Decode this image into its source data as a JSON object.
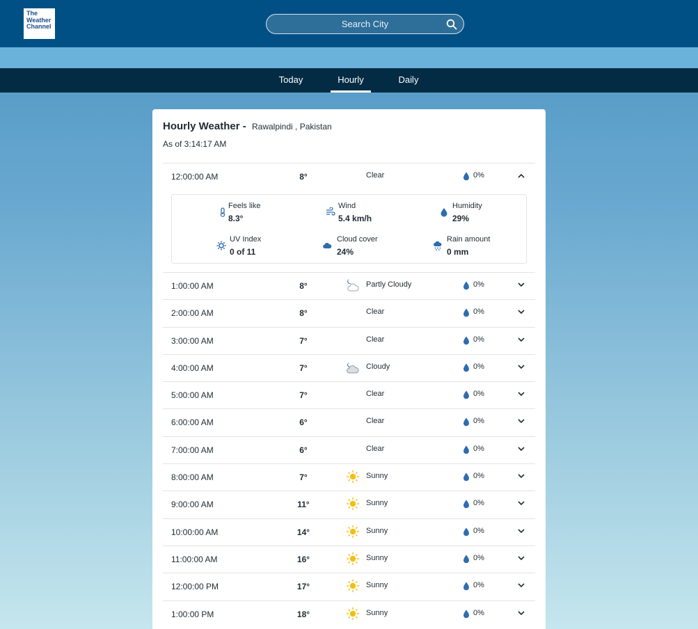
{
  "brand": {
    "logo_lines": [
      "The",
      "Weather",
      "Channel"
    ]
  },
  "search": {
    "placeholder": "Search City",
    "icon": "search-icon"
  },
  "nav": {
    "tabs": [
      "Today",
      "Hourly",
      "Daily"
    ],
    "active": "Hourly"
  },
  "header": {
    "title": "Hourly Weather -",
    "location": "Rawalpindi , Pakistan",
    "as_of": "As of 3:14:17 AM"
  },
  "colors": {
    "topbar": "#005086",
    "nav": "#032c44",
    "accent_icon": "#2f6cb0",
    "sun": "#f2c012"
  },
  "details": {
    "feels_like": {
      "label": "Feels like",
      "value": "8.3°",
      "icon": "thermometer-icon"
    },
    "wind": {
      "label": "Wind",
      "value": "5.4 km/h",
      "icon": "wind-icon"
    },
    "humidity": {
      "label": "Humidity",
      "value": "29%",
      "icon": "droplet-icon"
    },
    "uv_index": {
      "label": "UV Index",
      "value": "0 of 11",
      "icon": "uv-icon"
    },
    "cloud_cover": {
      "label": "Cloud cover",
      "value": "24%",
      "icon": "cloud-icon"
    },
    "rain_amount": {
      "label": "Rain amount",
      "value": "0 mm",
      "icon": "rain-icon"
    }
  },
  "hours": [
    {
      "time": "12:00:00 AM",
      "temp": "8°",
      "condition": "Clear",
      "icon": "moon-icon",
      "precip": "0%",
      "expanded": true
    },
    {
      "time": "1:00:00 AM",
      "temp": "8°",
      "condition": "Partly Cloudy",
      "icon": "partly-cloudy-night-icon",
      "precip": "0%"
    },
    {
      "time": "2:00:00 AM",
      "temp": "8°",
      "condition": "Clear",
      "icon": "moon-icon",
      "precip": "0%"
    },
    {
      "time": "3:00:00 AM",
      "temp": "7°",
      "condition": "Clear",
      "icon": "moon-icon",
      "precip": "0%"
    },
    {
      "time": "4:00:00 AM",
      "temp": "7°",
      "condition": "Cloudy",
      "icon": "cloudy-night-icon",
      "precip": "0%"
    },
    {
      "time": "5:00:00 AM",
      "temp": "7°",
      "condition": "Clear",
      "icon": "moon-icon",
      "precip": "0%"
    },
    {
      "time": "6:00:00 AM",
      "temp": "6°",
      "condition": "Clear",
      "icon": "moon-icon",
      "precip": "0%"
    },
    {
      "time": "7:00:00 AM",
      "temp": "6°",
      "condition": "Clear",
      "icon": "moon-icon",
      "precip": "0%"
    },
    {
      "time": "8:00:00 AM",
      "temp": "7°",
      "condition": "Sunny",
      "icon": "sun-icon",
      "precip": "0%"
    },
    {
      "time": "9:00:00 AM",
      "temp": "11°",
      "condition": "Sunny",
      "icon": "sun-icon",
      "precip": "0%"
    },
    {
      "time": "10:00:00 AM",
      "temp": "14°",
      "condition": "Sunny",
      "icon": "sun-icon",
      "precip": "0%"
    },
    {
      "time": "11:00:00 AM",
      "temp": "16°",
      "condition": "Sunny",
      "icon": "sun-icon",
      "precip": "0%"
    },
    {
      "time": "12:00:00 PM",
      "temp": "17°",
      "condition": "Sunny",
      "icon": "sun-icon",
      "precip": "0%"
    },
    {
      "time": "1:00:00 PM",
      "temp": "18°",
      "condition": "Sunny",
      "icon": "sun-icon",
      "precip": "0%"
    }
  ]
}
